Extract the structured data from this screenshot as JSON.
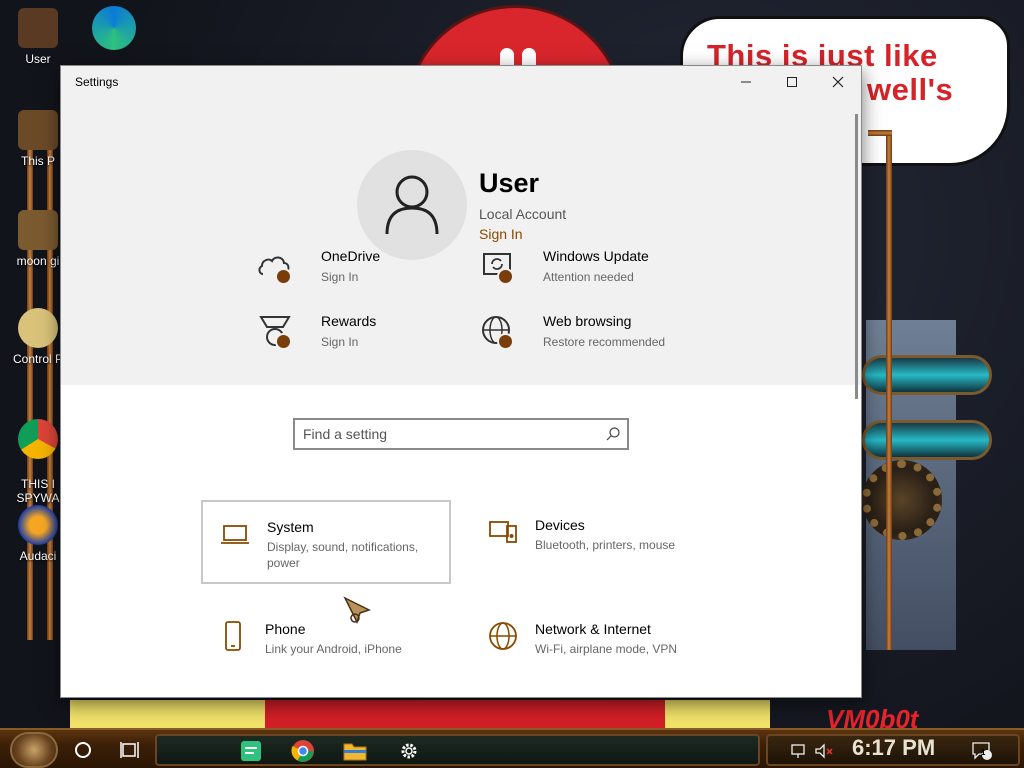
{
  "desktop": {
    "icons": [
      {
        "label": "User"
      },
      {
        "label": "This P"
      },
      {
        "label": "moon gi"
      },
      {
        "label": "Control P"
      },
      {
        "label": "THIS I\nSPYWA"
      },
      {
        "label": "Audaci"
      }
    ],
    "bubble": {
      "line1": "This is just like",
      "line2": "well's"
    },
    "watermark": "VM0b0t"
  },
  "window": {
    "title": "Settings",
    "controls": {
      "minimize": "—",
      "maximize": "☐",
      "close": "✕"
    },
    "account": {
      "name": "User",
      "type": "Local Account",
      "signin": "Sign In"
    },
    "quick_links": [
      {
        "title": "OneDrive",
        "subtitle": "Sign In",
        "icon": "cloud-icon"
      },
      {
        "title": "Windows Update",
        "subtitle": "Attention needed",
        "icon": "update-icon"
      },
      {
        "title": "Rewards",
        "subtitle": "Sign In",
        "icon": "medal-icon"
      },
      {
        "title": "Web browsing",
        "subtitle": "Restore recommended",
        "icon": "globe-icon"
      }
    ],
    "search": {
      "placeholder": "Find a setting",
      "value": ""
    },
    "categories": [
      {
        "title": "System",
        "subtitle": "Display, sound, notifications, power",
        "icon": "laptop-icon"
      },
      {
        "title": "Devices",
        "subtitle": "Bluetooth, printers, mouse",
        "icon": "keyboard-icon"
      },
      {
        "title": "Phone",
        "subtitle": "Link your Android, iPhone",
        "icon": "phone-icon"
      },
      {
        "title": "Network & Internet",
        "subtitle": "Wi-Fi, airplane mode, VPN",
        "icon": "globe-icon"
      }
    ],
    "accent": "#8a4a00"
  },
  "taskbar": {
    "apps": [
      "notes-icon",
      "chrome-icon",
      "file-explorer-icon",
      "settings-icon"
    ],
    "clock": "6:17 PM",
    "notification_count": "1"
  }
}
